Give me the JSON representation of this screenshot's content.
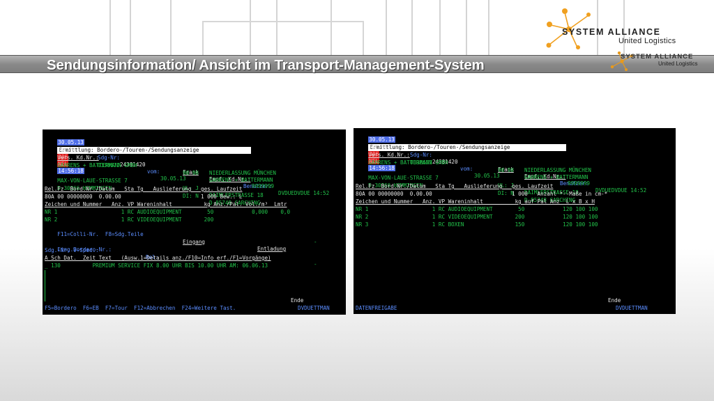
{
  "header": {
    "title": "Sendungsinformation/ Ansicht im Transport-Management-System"
  },
  "logo": {
    "brand": "SYSTEM ALLIANCE",
    "sub": "United Logistics",
    "brand_small": "SYSTEM ALLIANCE",
    "sub_small": "United Logistics"
  },
  "left": {
    "date": "30.05.13",
    "screen_title": "Ermittlung: Bordero-/Touren-/Sendungsanzeige",
    "code1": "306",
    "code2": "NEL",
    "time": "14:56:18",
    "nel": "300 NEL",
    "sdg_label": "Sdg-Nr:",
    "sdg_no": "24381420",
    "vom_label": "vom:",
    "vom_date": "30.05.13",
    "user_label": "Benutzer:",
    "user_value": "DVDUEDVDUE 14:52",
    "vers_label": "Vers. Kd.Nr.:",
    "vers_no": "0338677",
    "frank": "Frank",
    "empf_label": "Empf. Kd.Nr.:",
    "empf_no": "9999999",
    "sender_name": "GAHRENS + BATTERMANN GMBH",
    "frank_code": "90 90",
    "recv_name": "GAHRENS + BATTERMANN",
    "recv_branch": "NIEDERLASSUNG MÜNCHEN",
    "sender_street": "MAX-VON-LAUE-STRASSE 7",
    "ul": "UL: J",
    "recv_street": "DAIMLERSTRASSE 18",
    "sender_city": "D-30966 HEMMINGEN",
    "di": "DI: N",
    "recv_city": "D-85748 GARCHING",
    "relfz_header": "Rel.Fz  Bord.Nr./Datum   Sta Tg   Auslieferung   ges. Laufzeit",
    "relfz_row": "80A 00 00000000  0.00.00                         1 000 Bew.: L",
    "goods_header": "Zeichen und Nummer   Anz. VP Wareninhalt          kg Anz./Pal. Vol./m³  Lmtr",
    "goods_row1": "NR 1                    1 RC AUDIOEQUIPMENT        50            0,000    0,0",
    "goods_row2": "NR 2                    1 RC VIDEOEQUIPMENT       200",
    "f11": "F11=Colli-Nr.  F8=Sdg.Teile",
    "eingang": "Eingang",
    "entladung": "Entladung",
    "dash1": "-",
    "eing_label": "Eing.Bordero-Nr.:",
    "rel_label": "Rel:",
    "dash2": "-",
    "sdg_vsped": "Sdg.-Nr. V-Sped.:",
    "asch_header": "A Sch Dat.  Zeit Text   (Ausw.1=Details anz./F10=Info erf./F1=Vorgänge)",
    "asch_row": "_ 130          PREMIUM SERVICE FIX 8.00 UHR BIS 10.00 UHR AM: 06.06.13",
    "ende": "Ende",
    "fkeys": "F5=Bordero  F6=EB  F7=Tour  F12=Abbrechen  F24=Weitere Tast.",
    "user_bottom": "DVDUETTMAN"
  },
  "right": {
    "date": "30.05.13",
    "screen_title": "Ermittlung: Bordero-/Touren-/Sendungsanzeige",
    "code1": "306",
    "code2": "NEL",
    "time": "14:56:18",
    "nel": "300 NEL",
    "sdg_label": "Sdg-Nr:",
    "sdg_no": "24381420",
    "vom_label": "vom:",
    "vom_date": "30.05.13",
    "user_label": "Benutzer:",
    "user_value": "DVDUEDVDUE 14:52",
    "vers_label": "Vers. Kd.Nr.:",
    "vers_no": "0338677",
    "frank": "Frank",
    "empf_label": "Empf. Kd.Nr.:",
    "empf_no": "9999999",
    "sender_name": "GAHRENS + BATTERMANN GMBH",
    "frank_code": "90 90",
    "recv_name": "GAHRENS + BATTERMANN",
    "recv_branch": "NIEDERLASSUNG MÜNCHEN",
    "sender_street": "MAX-VON-LAUE-STRASSE 7",
    "ul": "UL: J",
    "recv_street": "DAIMLERSTRASSE 18",
    "sender_city": "D-30966 HEMMINGEN",
    "di": "DI: N",
    "recv_city": "D-85748 GARCHING",
    "relfz_header": "Rel.Fz  Bord.Nr./Datum   Sta Tg   Auslieferung   ges. Laufzeit",
    "relfz_row": "80A 00 00000000  0.00.00                         1 000   Anzahl *--Maße in cm-*",
    "goods_header": "Zeichen und Nummer   Anz. VP Wareninhalt          kg auf Pal Anz  L x B x H",
    "goods_row1": "NR 1                    1 RC AUDIOEQUIPMENT        50            120 100 100",
    "goods_row2": "NR 2                    1 RC VIDEOEQUIPMENT       200            120 100 100",
    "goods_row3": "NR 3                    1 RC BOXEN                150            120 100 100",
    "ende": "Ende",
    "datenfreigabe": "DATENFREIGABE",
    "user_bottom": "DVDUETTMAN"
  }
}
